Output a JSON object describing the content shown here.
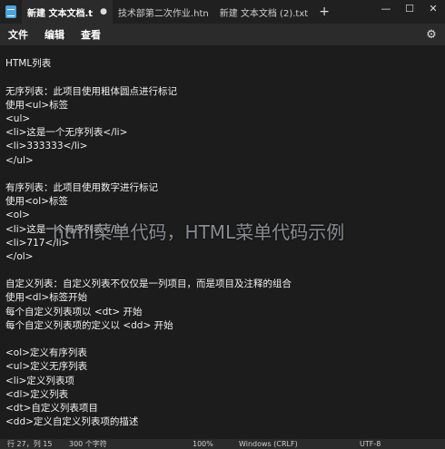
{
  "tabs": [
    {
      "label": "新建 文本文档.t",
      "modified_mark": "●"
    },
    {
      "label": "技术部第二次作业.htn"
    },
    {
      "label": "新建 文本文档 (2).txt"
    }
  ],
  "tab_add": "+",
  "window_controls": {
    "minimize": "—",
    "maximize": "☐",
    "close": "✕"
  },
  "menu": [
    "文件",
    "编辑",
    "查看"
  ],
  "lines": [
    "HTML列表",
    "",
    "无序列表：此项目使用粗体圆点进行标记",
    "使用<ul>标签",
    "<ul>",
    "<li>这是一个无序列表</li>",
    "<li>333333</li>",
    "</ul>",
    "",
    "有序列表：此项目使用数字进行标记",
    "使用<ol>标签",
    "<ol>",
    "<li>这是一个有序列表</li>",
    "<li>717</li>",
    "</ol>",
    "",
    "自定义列表：自定义列表不仅仅是一列项目，而是项目及注释的组合",
    "使用<dl>标签开始",
    "每个自定义列表项以 <dt> 开始",
    "每个自定义列表项的定义以 <dd> 开始",
    "",
    "<ol>定义有序列表",
    "<ul>定义无序列表",
    "<li>定义列表项",
    "<dl>定义列表",
    "<dt>自定义列表项目",
    "<dd>定义自定义列表项的描述"
  ],
  "watermark": "html菜单代码，HTML菜单代码示例",
  "status": {
    "position": "行 27，列 15",
    "chars": "300 个字符",
    "zoom": "100%",
    "line_ending": "Windows (CRLF)",
    "encoding": "UTF-8"
  }
}
